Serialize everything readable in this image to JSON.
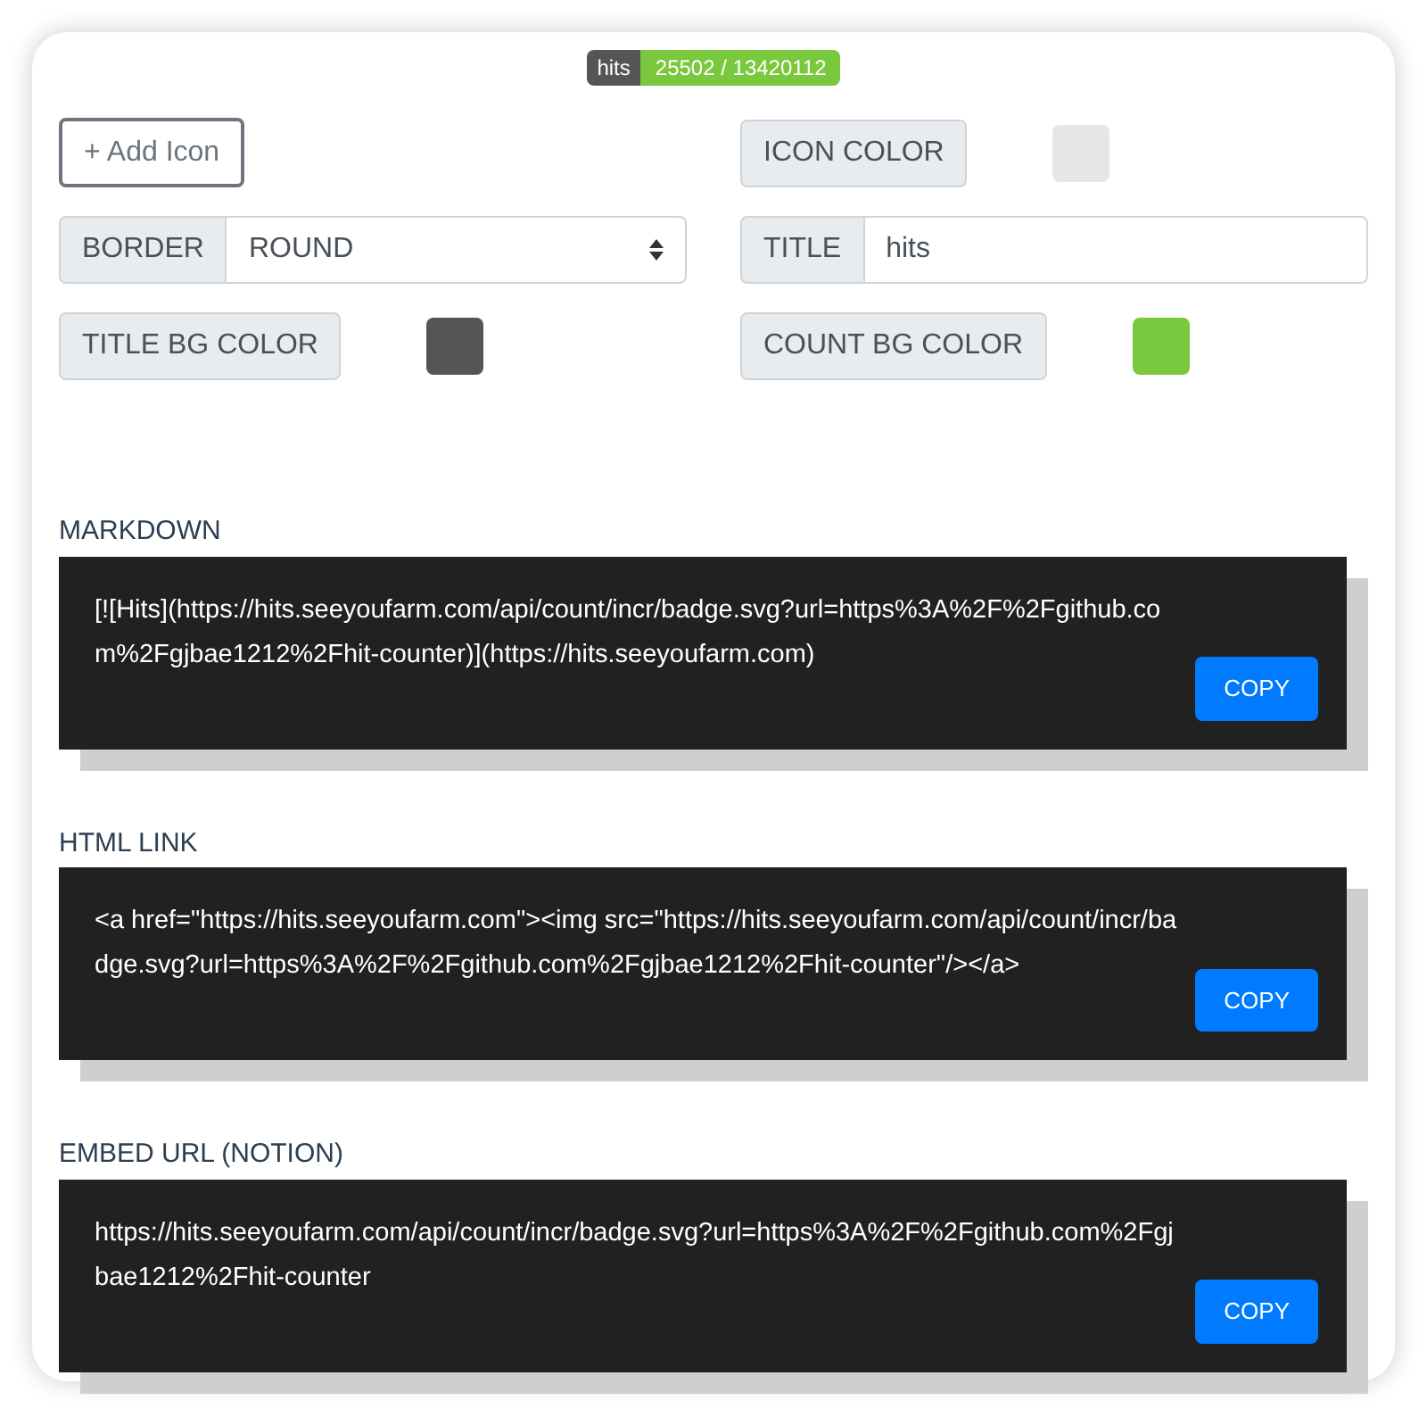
{
  "badge": {
    "title": "hits",
    "count": "25502 / 13420112"
  },
  "add_icon_button": "+ Add Icon",
  "icon_color": {
    "label": "ICON COLOR",
    "color": "#e6e6e6"
  },
  "border": {
    "label": "BORDER",
    "value": "ROUND"
  },
  "title": {
    "label": "TITLE",
    "value": "hits"
  },
  "title_bg_color": {
    "label": "TITLE BG COLOR",
    "color": "#555555"
  },
  "count_bg_color": {
    "label": "COUNT BG COLOR",
    "color": "#79c83d"
  },
  "snippets": [
    {
      "heading": "MARKDOWN",
      "code": "[![Hits](https://hits.seeyoufarm.com/api/count/incr/badge.svg?url=https%3A%2F%2Fgithub.com%2Fgjbae1212%2Fhit-counter)](https://hits.seeyoufarm.com)",
      "button": "COPY"
    },
    {
      "heading": "HTML LINK",
      "code": "<a href=\"https://hits.seeyoufarm.com\"><img src=\"https://hits.seeyoufarm.com/api/count/incr/badge.svg?url=https%3A%2F%2Fgithub.com%2Fgjbae1212%2Fhit-counter\"/></a>",
      "button": "COPY"
    },
    {
      "heading": "EMBED URL (NOTION)",
      "code": "https://hits.seeyoufarm.com/api/count/incr/badge.svg?url=https%3A%2F%2Fgithub.com%2Fgjbae1212%2Fhit-counter",
      "button": "COPY"
    }
  ]
}
